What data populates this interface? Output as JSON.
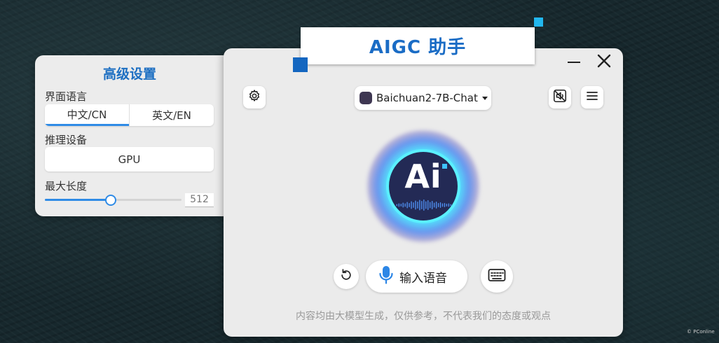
{
  "banner": {
    "title": "AIGC 助手"
  },
  "settings": {
    "title": "高级设置",
    "language_label": "界面语言",
    "language_options": [
      "中文/CN",
      "英文/EN"
    ],
    "language_selected": "中文/CN",
    "device_label": "推理设备",
    "device_value": "GPU",
    "max_length_label": "最大长度",
    "max_length_value": "512",
    "max_length_slider_fraction": 0.48
  },
  "main": {
    "model_selector": "Baichuan2-7B-Chat",
    "avatar_text": "Ai",
    "voice_input_label": "输入语音",
    "disclaimer": "内容均由大模型生成，仅供参考，不代表我们的态度或观点",
    "icons": {
      "settings": "gear-icon",
      "mute": "speaker-off-icon",
      "menu": "hamburger-menu-icon",
      "minimize": "minimize-icon",
      "close": "close-icon",
      "reset": "refresh-icon",
      "microphone": "microphone-icon",
      "keyboard": "keyboard-icon"
    }
  },
  "watermark": "© PConline",
  "colors": {
    "accent_blue": "#1a6cc5",
    "slider_blue": "#2f8be6",
    "mic_blue": "#2c86e6",
    "orb_cyan": "#5bf0ff",
    "orb_navy": "#232a55"
  }
}
